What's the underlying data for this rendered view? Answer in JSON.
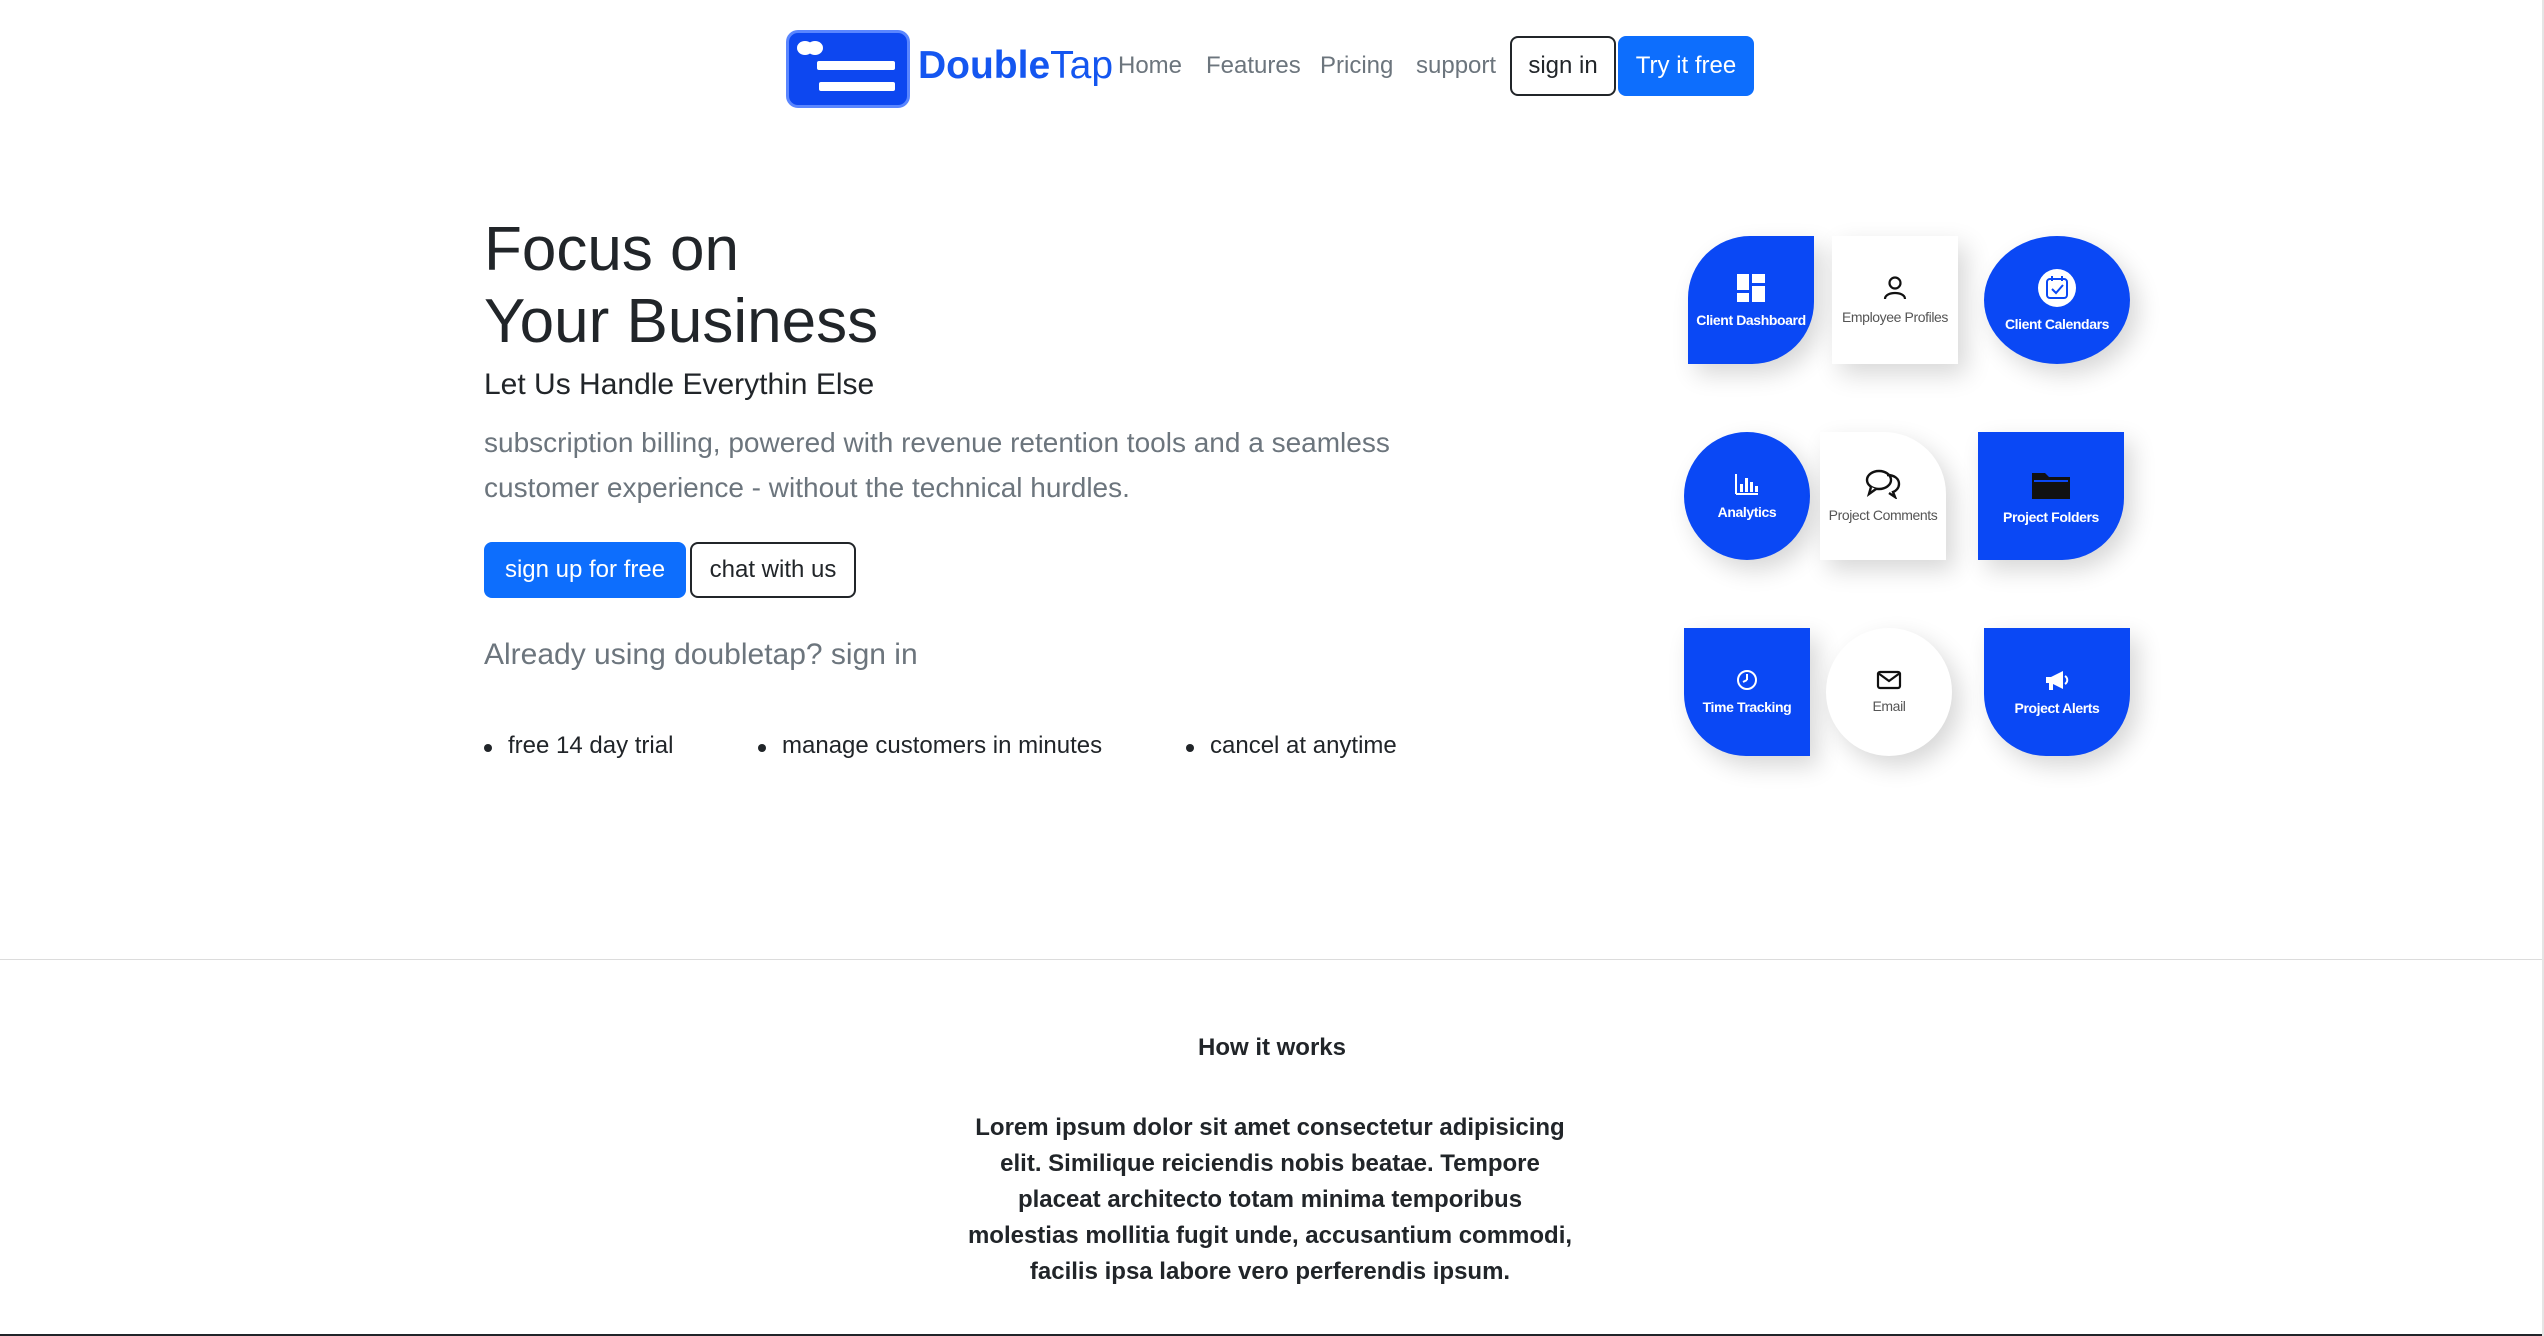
{
  "brand": {
    "name_bold": "Double",
    "name_thin": "Tap"
  },
  "nav": {
    "home": "Home",
    "features": "Features",
    "pricing": "Pricing",
    "support": "support",
    "sign_in": "sign in",
    "try_free": "Try it free"
  },
  "hero": {
    "title_line1": "Focus on",
    "title_line2": "Your Business",
    "subtitle": "Let Us Handle Everythin Else",
    "description": "subscription billing, powered with revenue retention tools and a seamless customer experience - without the technical hurdles.",
    "signup_button": "sign up for free",
    "chat_button": "chat with us",
    "already_text": "Already using doubletap? sign in",
    "bullets": [
      "free 14 day trial",
      "manage customers in minutes",
      "cancel at anytime"
    ]
  },
  "features": [
    {
      "label": "Client Dashboard",
      "icon": "dashboard-icon",
      "style": "blue"
    },
    {
      "label": "Employee Profiles",
      "icon": "person-icon",
      "style": "white"
    },
    {
      "label": "Client Calendars",
      "icon": "calendar-icon",
      "style": "blue"
    },
    {
      "label": "Analytics",
      "icon": "bar-chart-icon",
      "style": "blue"
    },
    {
      "label": "Project Comments",
      "icon": "chat-bubbles-icon",
      "style": "white"
    },
    {
      "label": "Project Folders",
      "icon": "folder-icon",
      "style": "blue"
    },
    {
      "label": "Time Tracking",
      "icon": "clock-icon",
      "style": "blue"
    },
    {
      "label": "Email",
      "icon": "envelope-icon",
      "style": "white"
    },
    {
      "label": "Project Alerts",
      "icon": "megaphone-icon",
      "style": "blue"
    }
  ],
  "how_it_works": {
    "title": "How it works",
    "body": "Lorem ipsum dolor sit amet consectetur adipisicing elit. Similique reiciendis nobis beatae. Tempore placeat architecto totam minima temporibus molestias mollitia fugit unde, accusantium commodi, facilis ipsa labore vero perferendis ipsum."
  },
  "colors": {
    "primary": "#0d6efd",
    "tile_blue": "#0a48f5",
    "brand_text": "#1456f0",
    "muted": "#6c757d"
  }
}
